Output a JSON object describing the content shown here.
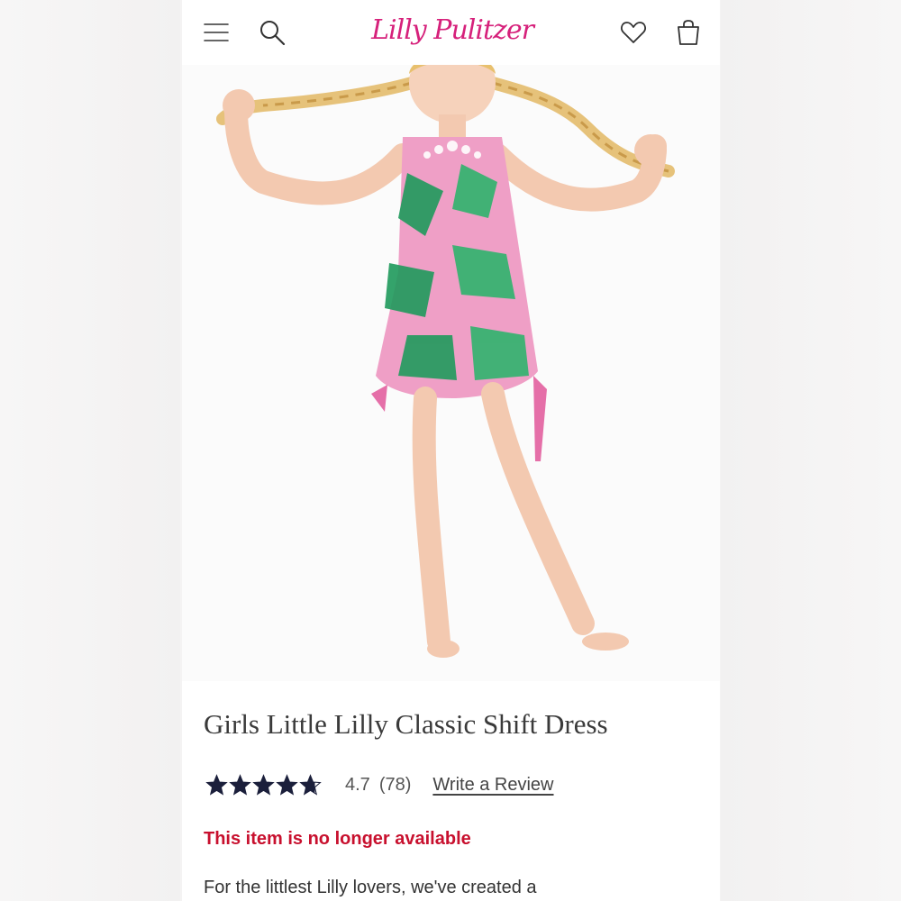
{
  "header": {
    "brand": "Lilly Pulitzer",
    "brand_color": "#d6217b",
    "icons": [
      "menu-icon",
      "search-icon",
      "heart-icon",
      "bag-icon"
    ]
  },
  "product": {
    "title": "Girls Little Lilly Classic Shift Dress",
    "rating": "4.7",
    "rating_value": 4.7,
    "rating_max": 5,
    "review_count": "(78)",
    "write_review_label": "Write a Review",
    "availability": "This item is no longer available",
    "availability_color": "#c8102e",
    "star_color": "#1b1f3b",
    "description": "For the littlest Lilly lovers, we've created a"
  }
}
